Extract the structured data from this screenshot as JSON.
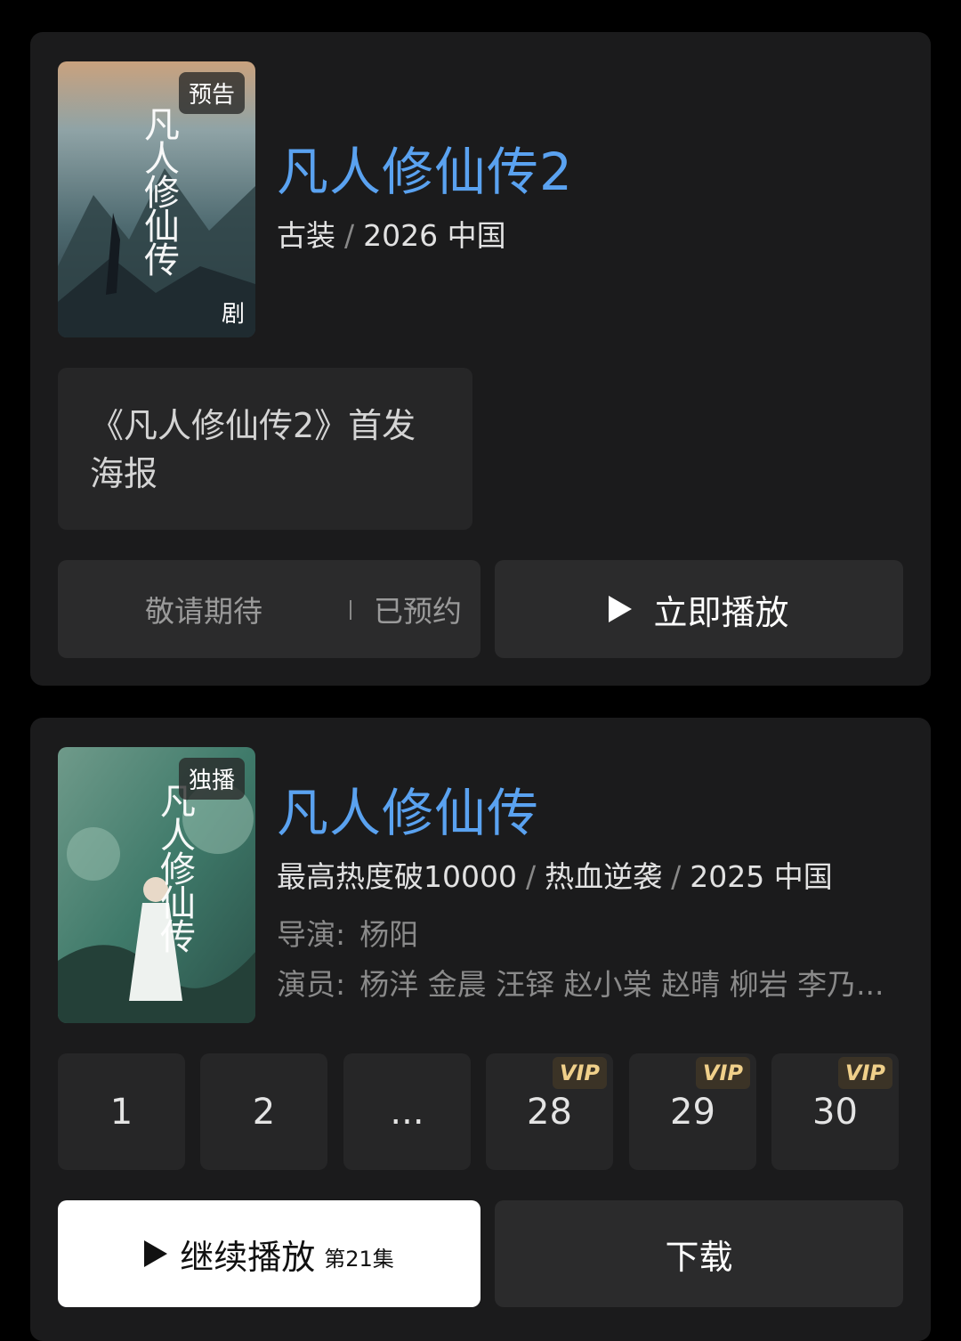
{
  "shows": [
    {
      "poster_badge": "预告",
      "poster_corner": "剧",
      "poster_title": "凡人修仙传",
      "title": "凡人修仙传2",
      "meta": [
        "古装",
        "2026 中国"
      ],
      "notice": "《凡人修仙传2》首发海报",
      "reserve_label": "敬请期待",
      "reserved_label": "已预约",
      "play_label": "立即播放"
    },
    {
      "poster_badge": "独播",
      "poster_title": "凡人修仙传",
      "title": "凡人修仙传",
      "meta": [
        "最高热度破10000",
        "热血逆袭",
        "2025 中国"
      ],
      "director_label": "导演:",
      "director": "杨阳",
      "cast_label": "演员:",
      "cast": "杨洋 金晨 汪铎 赵小棠 赵晴 柳岩 李乃...",
      "episodes": [
        {
          "label": "1",
          "vip": ""
        },
        {
          "label": "2",
          "vip": ""
        },
        {
          "label": "...",
          "vip": ""
        },
        {
          "label": "28",
          "vip": "VIP"
        },
        {
          "label": "29",
          "vip": "VIP"
        },
        {
          "label": "30",
          "vip": "VIP"
        }
      ],
      "continue_label": "继续播放",
      "continue_episode": "第21集",
      "download_label": "下载"
    }
  ],
  "colors": {
    "title": "#5aa2f0",
    "card": "#1b1b1c",
    "button": "#2b2b2c",
    "vip": "#f0d08a"
  }
}
